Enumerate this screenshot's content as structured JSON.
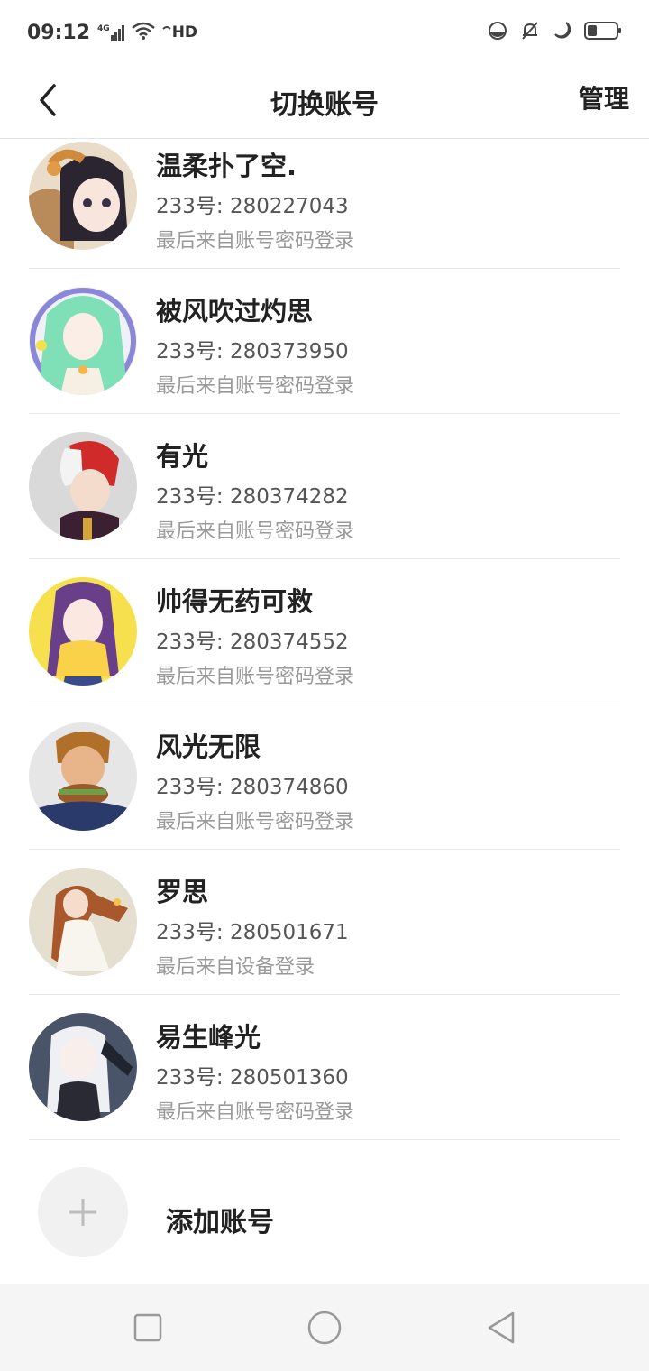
{
  "status_bar": {
    "time": "09:12",
    "network": "4G",
    "hd": "HD",
    "icons": [
      "signal-icon",
      "wifi-icon",
      "hd-call-icon",
      "data-saver-icon",
      "mute-icon",
      "moon-icon",
      "battery-icon"
    ]
  },
  "header": {
    "title": "切换账号",
    "manage_label": "管理",
    "back_icon": "chevron-left-icon"
  },
  "accounts": [
    {
      "name": "温柔扑了空.",
      "id": "233号: 280227043",
      "login": "最后来自账号密码登录"
    },
    {
      "name": "被风吹过灼思",
      "id": "233号: 280373950",
      "login": "最后来自账号密码登录"
    },
    {
      "name": "有光",
      "id": "233号: 280374282",
      "login": "最后来自账号密码登录"
    },
    {
      "name": "帅得无药可救",
      "id": "233号: 280374552",
      "login": "最后来自账号密码登录"
    },
    {
      "name": "风光无限",
      "id": "233号: 280374860",
      "login": "最后来自账号密码登录"
    },
    {
      "name": "罗思",
      "id": "233号: 280501671",
      "login": "最后来自设备登录"
    },
    {
      "name": "易生峰光",
      "id": "233号: 280501360",
      "login": "最后来自账号密码登录"
    }
  ],
  "add_account": {
    "label": "添加账号",
    "icon": "plus-icon"
  },
  "nav_bar": {
    "icons": [
      "recent-apps-icon",
      "home-icon",
      "back-icon"
    ]
  },
  "colors": {
    "divider": "#e8e8e8",
    "secondary_text": "#999999",
    "nav_background": "#f5f5f5"
  }
}
